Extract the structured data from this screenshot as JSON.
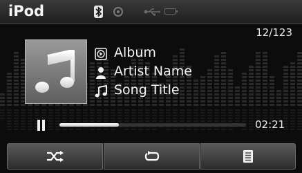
{
  "app": {
    "title": "iPod"
  },
  "status": {
    "icons": [
      "bluetooth-icon",
      "disc-icon",
      "usb-icon",
      "battery-icon"
    ]
  },
  "track": {
    "counter": "12/123",
    "album": "Album",
    "artist": "Artist Name",
    "song": "Song Title"
  },
  "playback": {
    "state": "playing",
    "elapsed": "02:21",
    "progress_fraction": 0.32
  },
  "controls": {
    "buttons": [
      "shuffle-icon",
      "repeat-icon",
      "list-icon"
    ]
  },
  "colors": {
    "background": "#0c0c0c",
    "accent": "#f2f2f2"
  }
}
